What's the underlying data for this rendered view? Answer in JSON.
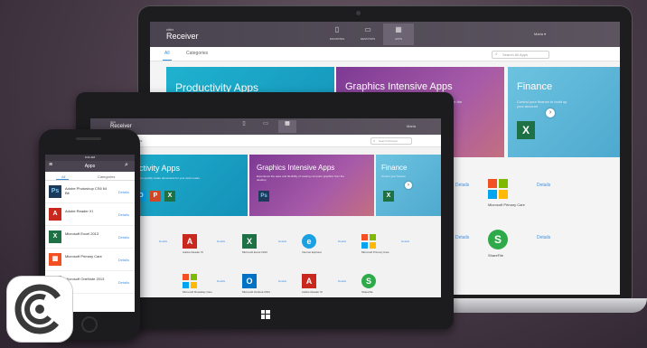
{
  "laptop": {
    "brand_small": "citrix",
    "brand": "Receiver",
    "nav": [
      {
        "icon": "favorites-icon",
        "glyph": "▯",
        "label": "FAVORITES"
      },
      {
        "icon": "desktops-icon",
        "glyph": "▭",
        "label": "DESKTOPS"
      },
      {
        "icon": "apps-icon",
        "glyph": "▦",
        "label": "APPS"
      }
    ],
    "user": "Maria ▾",
    "tabs": {
      "all": "All",
      "categories": "Categories"
    },
    "search_placeholder": "Search All Apps",
    "banners": [
      {
        "title": "Productivity Apps",
        "subtitle": "Find Apps to help you quickly create documents for your work needs"
      },
      {
        "title": "Graphics Intensive Apps",
        "subtitle": "Experience the ease and flexibility of viewing computer graphics from the desktop"
      },
      {
        "title": "Finance",
        "subtitle": "Control your finance to build up your account"
      }
    ],
    "apps": [
      {
        "name": "Microsoft Primary Care",
        "details": "Details"
      },
      {
        "name": "ShareFile",
        "details": "Details"
      }
    ],
    "details_label": "Details"
  },
  "tablet": {
    "brand_small": "citrix",
    "brand": "Receiver",
    "tabs": {
      "all": "All",
      "categories": "Categories"
    },
    "user": "Maria",
    "search_placeholder": "Search All Apps",
    "banners": [
      {
        "title": "Productivity Apps",
        "subtitle": "Find Apps to help you quickly create documents for your work needs"
      },
      {
        "title": "Graphics Intensive Apps",
        "subtitle": "Experience the ease and flexibility of viewing computer graphics from the desktop"
      },
      {
        "title": "Finance",
        "subtitle": "Control your finance"
      }
    ],
    "apps_row1": [
      {
        "name": "Adobe Photoshop CS6 & Bit"
      },
      {
        "name": "Adobe Reader XI"
      },
      {
        "name": "Microsoft Excel 2013"
      },
      {
        "name": "Internet Explorer"
      },
      {
        "name": "Microsoft Primary Care"
      }
    ],
    "apps_row2": [
      {
        "name": "Microsoft Rowaday Care"
      },
      {
        "name": "Microsoft Outlook 2013"
      },
      {
        "name": "Adobe Reader XI"
      },
      {
        "name": "ShareFile"
      }
    ],
    "details_label": "Details"
  },
  "phone": {
    "status": "9:41 AM",
    "title": "Apps",
    "tabs": {
      "all": "All",
      "categories": "Categories"
    },
    "rows": [
      {
        "name": "Adobe Photoshop CS6 64 Bit",
        "tile": "Ps",
        "color": "#1c3a5a",
        "details": "Details"
      },
      {
        "name": "Adobe Reader XI",
        "tile": "A",
        "color": "#c8281e",
        "details": "Details"
      },
      {
        "name": "Microsoft Excel 2013",
        "tile": "X",
        "color": "#1e7145",
        "details": "Details"
      },
      {
        "name": "Microsoft Primary Care",
        "tile": "▦",
        "color": "#f25022",
        "details": "Details"
      },
      {
        "name": "Microsoft OneNote 2013",
        "tile": "N",
        "color": "#7b3f9b",
        "details": "Details"
      }
    ]
  },
  "colors": {
    "accent": "#4a90d9",
    "header": "#4a4450",
    "productivity": "#1fa9c9",
    "graphics": "#8c3f9e",
    "finance": "#6ac0df"
  }
}
